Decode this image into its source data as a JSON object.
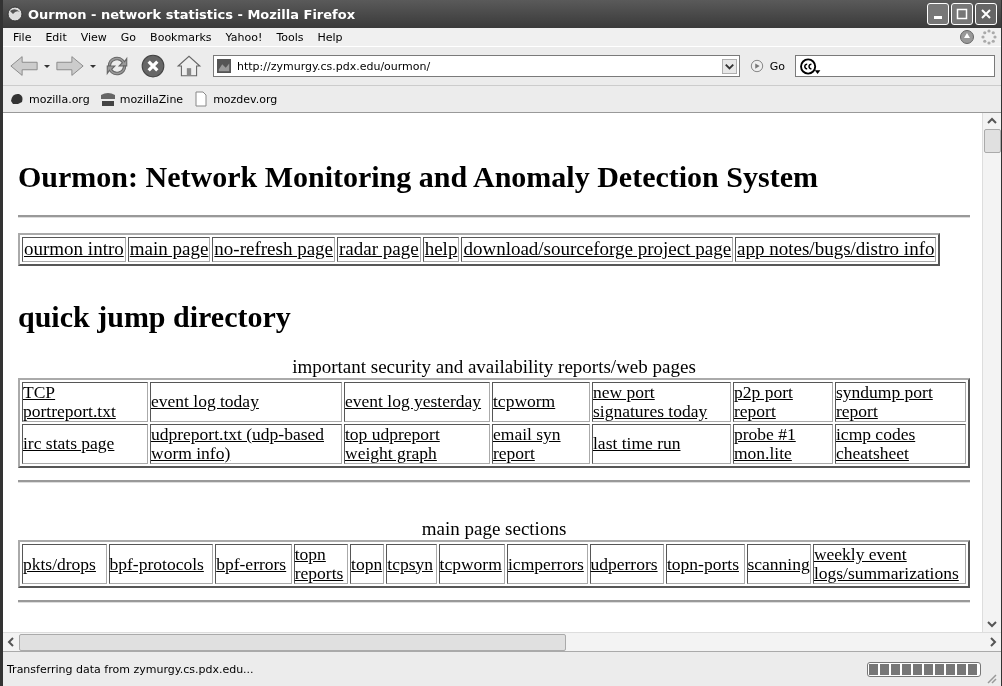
{
  "window": {
    "title": "Ourmon - network statistics - Mozilla Firefox"
  },
  "menu": [
    "File",
    "Edit",
    "View",
    "Go",
    "Bookmarks",
    "Yahoo!",
    "Tools",
    "Help"
  ],
  "address": {
    "value": "http://zymurgy.cs.pdx.edu/ourmon/"
  },
  "go_label": "Go",
  "bookmarks": [
    "mozilla.org",
    "mozillaZine",
    "mozdev.org"
  ],
  "page": {
    "heading": "Ourmon: Network Monitoring and Anomaly Detection System",
    "nav_links": [
      "ourmon intro",
      "main page",
      "no-refresh page",
      "radar page",
      "help",
      "download/sourceforge project page",
      "app notes/bugs/distro info"
    ],
    "section_heading": "quick jump directory",
    "tables": [
      {
        "caption": "important security and availability reports/web pages",
        "rows": [
          [
            "TCP portreport.txt",
            "event log today",
            "event log yesterday",
            "tcpworm",
            "new port signatures today",
            "p2p port report",
            "syndump port report"
          ],
          [
            "irc stats page",
            "udpreport.txt (udp-based worm info)",
            "top udpreport weight graph",
            "email syn report",
            "last time run",
            "probe #1 mon.lite",
            "icmp codes cheatsheet"
          ]
        ]
      },
      {
        "caption": "main page sections",
        "rows": [
          [
            "pkts/drops",
            "bpf-protocols",
            "bpf-errors",
            "topn reports",
            "topn",
            "tcpsyn",
            "tcpworm",
            "icmperrors",
            "udperrors",
            "topn-ports",
            "scanning",
            "weekly event logs/summarizations"
          ]
        ]
      }
    ]
  },
  "status_bar": {
    "text": "Transferring data from zymurgy.cs.pdx.edu...",
    "progress": {
      "level": 1
    }
  }
}
